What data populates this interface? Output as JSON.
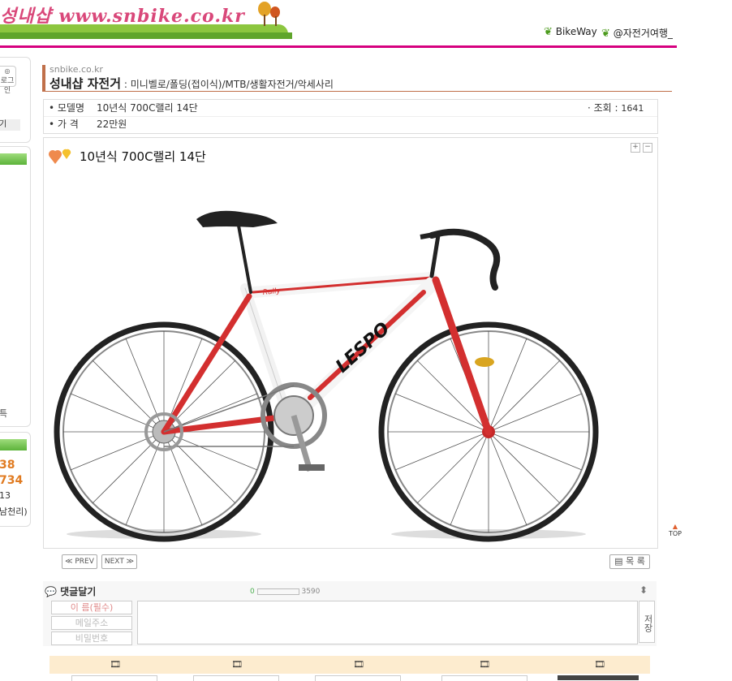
{
  "header": {
    "logo_text": "성내샵 www.snbike.co.kr",
    "links": [
      "BikeWay",
      "@자전거여행_"
    ]
  },
  "sidebar": {
    "login_label": "로그인",
    "item_label": "기",
    "side_char": "특",
    "counter_1": "38",
    "counter_2": "734",
    "counter_3": "13",
    "counter_4": "남천리)"
  },
  "title": {
    "site": "snbike.co.kr",
    "name": "성내샵 자전거",
    "categories": ": 미니벨로/폴딩(접이식)/MTB/생활자전거/악세사리"
  },
  "info": {
    "model_label": "• 모델명",
    "model_value": "10년식 700C랠리 14단",
    "price_label": "• 가 격",
    "price_value": "22만원",
    "views_label": "· 조회 :",
    "views_value": "1641"
  },
  "post": {
    "title": "10년식 700C랠리 14단",
    "zoom_in": "+",
    "zoom_out": "−",
    "image_alt": "LESPO Rally road bike"
  },
  "nav": {
    "prev": "≪ PREV",
    "next": "NEXT ≫",
    "list": "목 록"
  },
  "comment": {
    "heading": "댓글달기",
    "counter_start": "0",
    "counter_max": "3590",
    "name_placeholder": "이 름(필수)",
    "email_placeholder": "메일주소",
    "password_placeholder": "비밀번호",
    "save": "저장"
  },
  "top_button": "TOP",
  "colors": {
    "brand_pink": "#d6007f",
    "accent_brown": "#c0704a",
    "green": "#5cb33a"
  }
}
